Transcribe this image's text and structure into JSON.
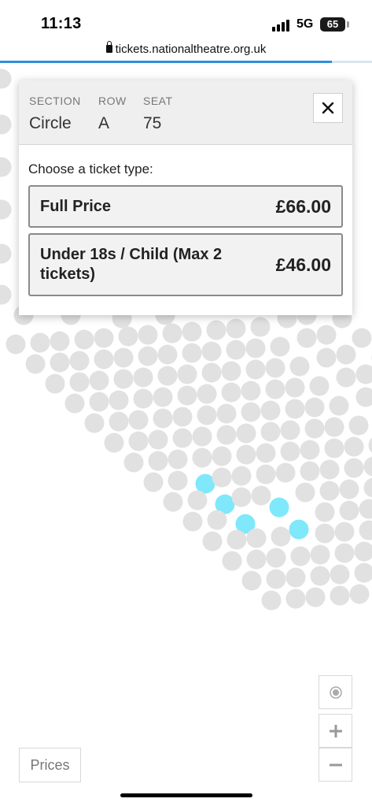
{
  "status_bar": {
    "time": "11:13",
    "network": "5G",
    "battery": "65"
  },
  "browser": {
    "url": "tickets.nationaltheatre.org.uk"
  },
  "seat_popup": {
    "section_label": "SECTION",
    "section_value": "Circle",
    "row_label": "ROW",
    "row_value": "A",
    "seat_label": "SEAT",
    "seat_value": "75",
    "prompt": "Choose a ticket type:",
    "ticket_types": [
      {
        "name": "Full Price",
        "price": "£66.00"
      },
      {
        "name": "Under 18s / Child (Max 2 tickets)",
        "price": "£46.00"
      }
    ]
  },
  "map_controls": {
    "prices_label": "Prices"
  },
  "colors": {
    "available_seat": "#e1e1e1",
    "highlighted_seat": "#7fe8fb",
    "progress": "#2f8fd8"
  }
}
